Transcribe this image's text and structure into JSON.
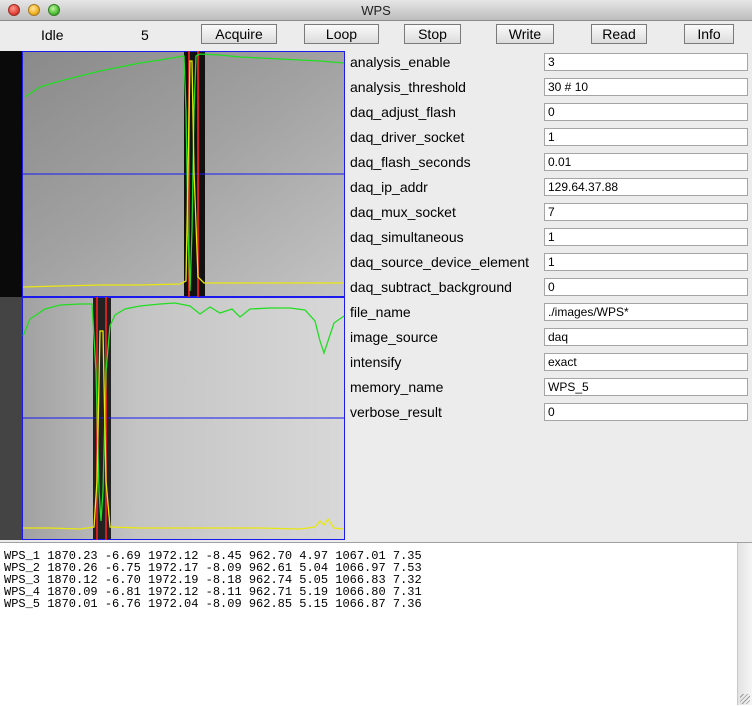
{
  "window": {
    "title": "WPS"
  },
  "toolbar": {
    "status": "Idle",
    "counter": "5",
    "buttons": [
      "Acquire",
      "Loop",
      "Stop",
      "Write",
      "Read",
      "Info"
    ]
  },
  "params": [
    {
      "name": "analysis_enable",
      "value": "3"
    },
    {
      "name": "analysis_threshold",
      "value": "30 # 10"
    },
    {
      "name": "daq_adjust_flash",
      "value": "0"
    },
    {
      "name": "daq_driver_socket",
      "value": "1"
    },
    {
      "name": "daq_flash_seconds",
      "value": "0.01"
    },
    {
      "name": "daq_ip_addr",
      "value": "129.64.37.88"
    },
    {
      "name": "daq_mux_socket",
      "value": "7"
    },
    {
      "name": "daq_simultaneous",
      "value": "1"
    },
    {
      "name": "daq_source_device_element",
      "value": "1"
    },
    {
      "name": "daq_subtract_background",
      "value": "0"
    },
    {
      "name": "file_name",
      "value": "./images/WPS*"
    },
    {
      "name": "image_source",
      "value": "daq"
    },
    {
      "name": "intensify",
      "value": "exact"
    },
    {
      "name": "memory_name",
      "value": "WPS_5"
    },
    {
      "name": "verbose_result",
      "value": "0"
    }
  ],
  "results": [
    "WPS_1 1870.23 -6.69 1972.12 -8.45 962.70 4.97 1067.01 7.35",
    "WPS_2 1870.26 -6.75 1972.17 -8.09 962.61 5.04 1066.97 7.53",
    "WPS_3 1870.12 -6.70 1972.19 -8.18 962.74 5.05 1066.83 7.32",
    "WPS_4 1870.09 -6.81 1972.12 -8.11 962.71 5.19 1066.80 7.31",
    "WPS_5 1870.01 -6.76 1972.04 -8.09 962.85 5.15 1066.87 7.36"
  ],
  "colors": {
    "profile_green": "#22dd22",
    "profile_yellow": "#e8e810",
    "crosshair_blue": "#1a1aee",
    "wire_red": "#d02020"
  },
  "icons": {
    "close": "red-circle",
    "minimize": "yellow-circle",
    "zoom": "green-circle"
  }
}
